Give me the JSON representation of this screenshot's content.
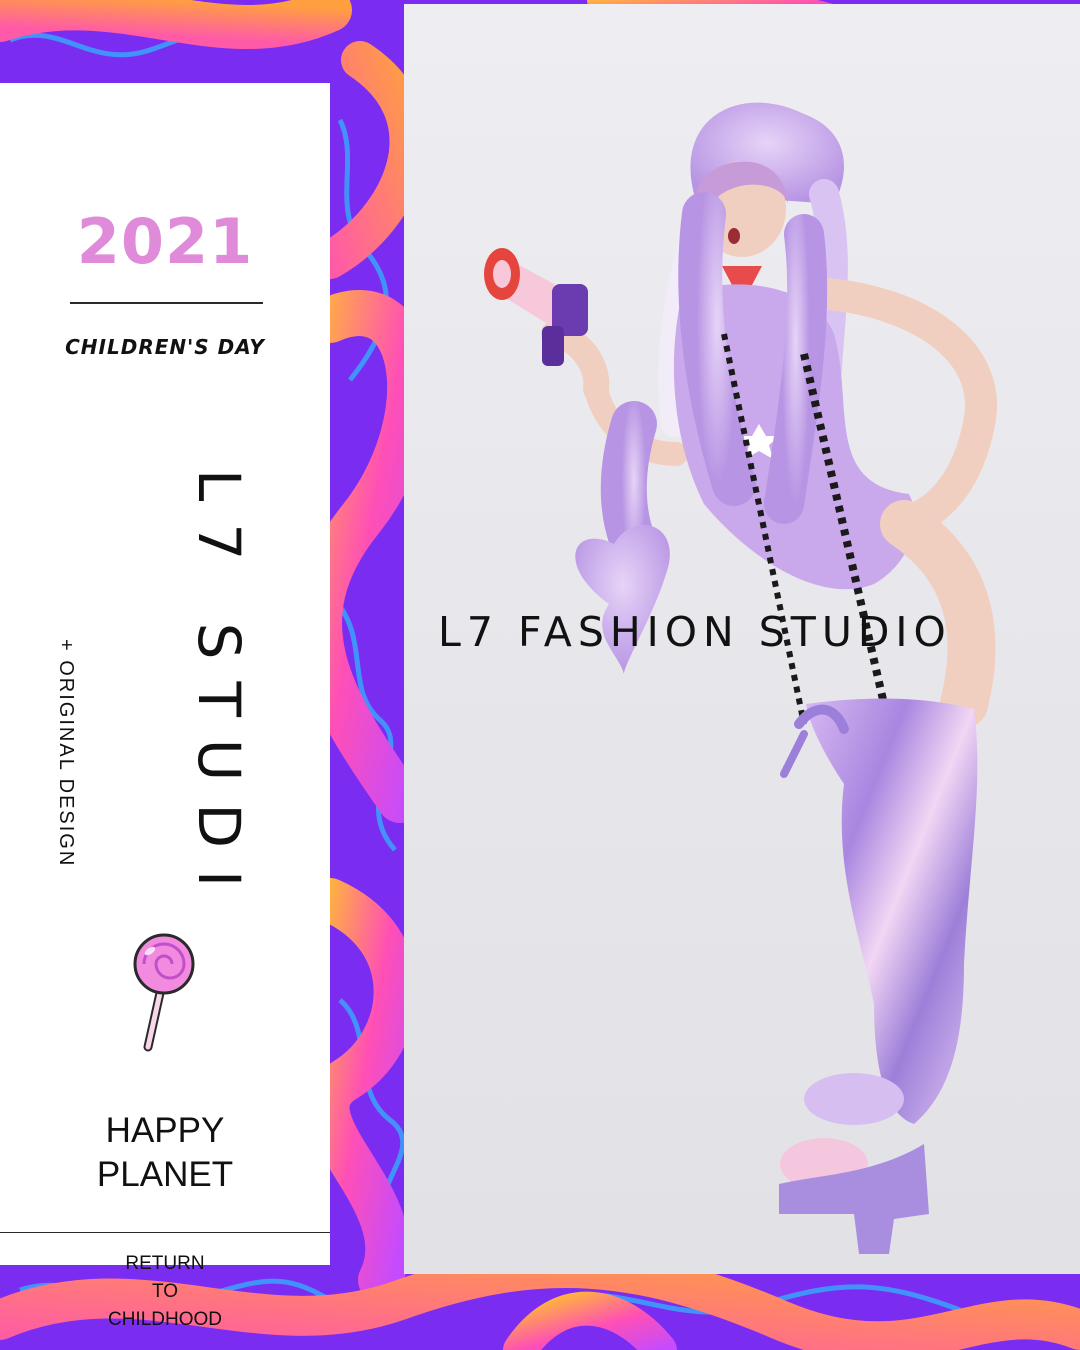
{
  "colors": {
    "year": "#e08bd9",
    "background_purple": "#7a2cf0",
    "tube_pink": "#ff4fb6",
    "tube_orange": "#ff9a3c",
    "marble_blue": "#2fb6ff",
    "outfit_lavender": "#c9a8ec"
  },
  "panel": {
    "year": "2021",
    "subtitle": "CHILDREN'S DAY",
    "brand_vertical": "L7 STUDI",
    "tag_vertical": "+ ORIGINAL  DESIGN",
    "lollipop_icon": "lollipop-icon",
    "tagline": [
      "HAPPY",
      "PLANET"
    ],
    "return_text": [
      "RETURN",
      "TO",
      "CHILDHOOD"
    ]
  },
  "photo": {
    "overlay_title": "L7 FASHION STUDIO"
  }
}
